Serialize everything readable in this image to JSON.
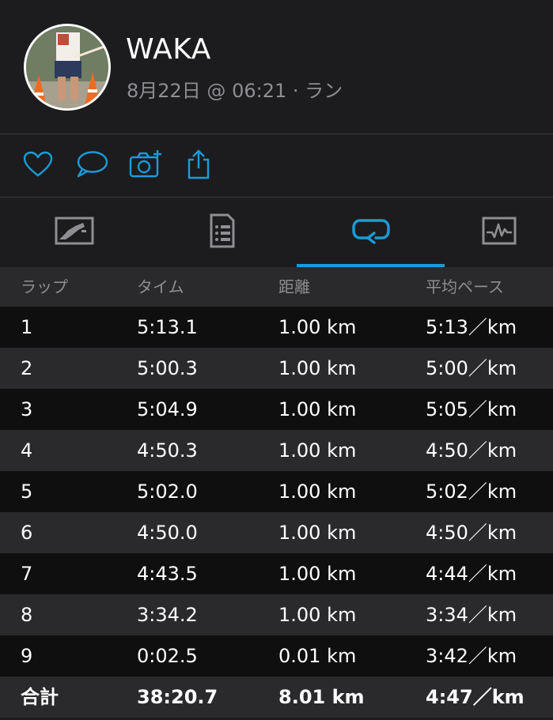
{
  "profile": {
    "name": "WAKA",
    "subtitle": "8月22日 @ 06:21 · ラン"
  },
  "actions": [
    {
      "icon": "heart-icon"
    },
    {
      "icon": "comment-icon"
    },
    {
      "icon": "add-photo-icon"
    },
    {
      "icon": "share-icon"
    }
  ],
  "tabs": [
    {
      "icon": "map-icon",
      "active": false
    },
    {
      "icon": "details-icon",
      "active": false
    },
    {
      "icon": "laps-icon",
      "active": true
    },
    {
      "icon": "charts-icon",
      "active": false
    }
  ],
  "colors": {
    "accent": "#1a9bd7",
    "background": "#1c1c1e",
    "muted": "#8e8e93"
  },
  "laps": {
    "headers": [
      "ラップ",
      "タイム",
      "距離",
      "平均ペース"
    ],
    "rows": [
      [
        "1",
        "5:13.1",
        "1.00 km",
        "5:13／km"
      ],
      [
        "2",
        "5:00.3",
        "1.00 km",
        "5:00／km"
      ],
      [
        "3",
        "5:04.9",
        "1.00 km",
        "5:05／km"
      ],
      [
        "4",
        "4:50.3",
        "1.00 km",
        "4:50／km"
      ],
      [
        "5",
        "5:02.0",
        "1.00 km",
        "5:02／km"
      ],
      [
        "6",
        "4:50.0",
        "1.00 km",
        "4:50／km"
      ],
      [
        "7",
        "4:43.5",
        "1.00 km",
        "4:44／km"
      ],
      [
        "8",
        "3:34.2",
        "1.00 km",
        "3:34／km"
      ],
      [
        "9",
        "0:02.5",
        "0.01 km",
        "3:42／km"
      ]
    ],
    "total": [
      "合計",
      "38:20.7",
      "8.01 km",
      "4:47／km"
    ]
  }
}
